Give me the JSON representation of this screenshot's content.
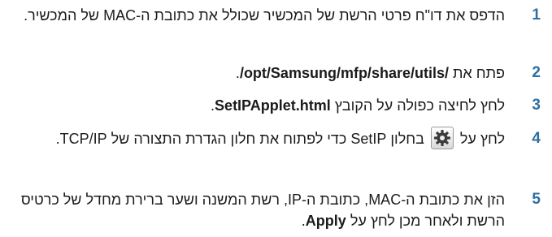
{
  "steps": [
    {
      "number": "1",
      "text": "הדפס את דו\"ח פרטי הרשת של המכשיר שכולל את כתובת ה-MAC של המכשיר."
    },
    {
      "number": "2",
      "prefix": "פתח את ",
      "bold": "/opt/Samsung/mfp/share/utils/",
      "suffix": "."
    },
    {
      "number": "3",
      "prefix": "לחץ לחיצה כפולה על הקובץ ",
      "bold": "SetIPApplet.html",
      "suffix": "."
    },
    {
      "number": "4",
      "prefix": "לחץ על ",
      "suffix": " בחלון SetIP כדי לפתוח את חלון הגדרת התצורה של TCP/IP.",
      "icon": "settings-gear-icon"
    },
    {
      "number": "5",
      "prefix": "הזן את כתובת ה-MAC, כתובת ה-IP, רשת המשנה ושער ברירת מחדל של כרטיס הרשת ולאחר מכן לחץ על ",
      "bold": "Apply",
      "suffix": "."
    }
  ],
  "colors": {
    "step_number": "#2e6fa1",
    "text": "#1b1b1b"
  }
}
